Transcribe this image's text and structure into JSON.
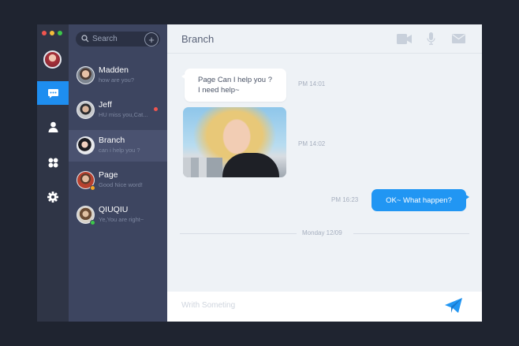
{
  "colors": {
    "accent": "#2196f3",
    "rail_bg": "#2f3546",
    "list_bg": "#3d4560",
    "chat_bg": "#eef2f6",
    "traffic_red": "#f0554f",
    "traffic_yellow": "#f4bd3a",
    "traffic_green": "#3cc84a",
    "unread_dot": "#f0554f",
    "status_orange": "#f5a623",
    "status_green": "#3cc84a"
  },
  "rail": {
    "items": [
      {
        "icon": "chat-bubble-icon",
        "active": true
      },
      {
        "icon": "user-icon",
        "active": false
      },
      {
        "icon": "apps-icon",
        "active": false
      },
      {
        "icon": "gear-icon",
        "active": false
      }
    ]
  },
  "search": {
    "placeholder": "Search",
    "add_icon": "plus-icon"
  },
  "contacts": [
    {
      "name": "Madden",
      "preview": "how are you?",
      "status": "none",
      "unread": false,
      "active": false
    },
    {
      "name": "Jeff",
      "preview": "HU miss you,Cat...",
      "status": "none",
      "unread": true,
      "active": false
    },
    {
      "name": "Branch",
      "preview": "can i help you ?",
      "status": "none",
      "unread": false,
      "active": true
    },
    {
      "name": "Page",
      "preview": "Good Nice word!",
      "status": "orange",
      "unread": false,
      "active": false
    },
    {
      "name": "QIUQIU",
      "preview": "Ye,You are right~",
      "status": "green",
      "unread": false,
      "active": false
    }
  ],
  "chat": {
    "title": "Branch",
    "header_icons": [
      "video-camera-icon",
      "microphone-icon",
      "mail-icon"
    ],
    "messages": [
      {
        "direction": "in",
        "type": "text",
        "lines": [
          "Page Can I help you ?",
          "I need help~"
        ],
        "time": "PM 14:01"
      },
      {
        "direction": "in",
        "type": "image",
        "time": "PM 14:02"
      },
      {
        "direction": "out",
        "type": "text",
        "text": "OK~ What happen?",
        "time": "PM 16:23"
      }
    ],
    "date_divider": "Monday 12/09",
    "composer": {
      "placeholder": "Writh Someting",
      "send_icon": "paper-plane-icon"
    }
  }
}
